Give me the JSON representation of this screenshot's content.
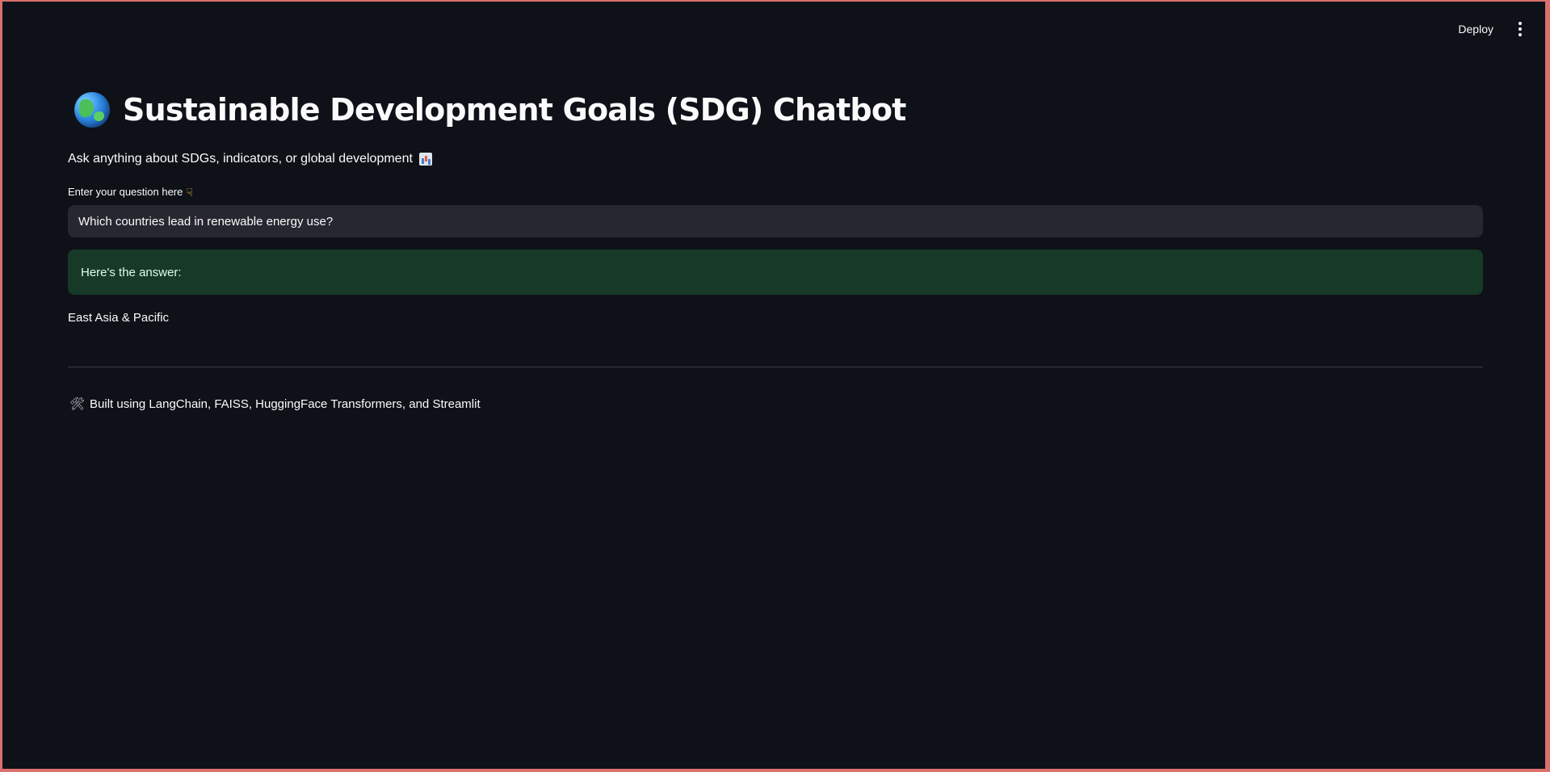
{
  "header": {
    "deploy_label": "Deploy",
    "menu_icon": "more-vertical-icon"
  },
  "main": {
    "title_icon": "globe-icon",
    "title": "Sustainable Development Goals (SDG) Chatbot",
    "subtitle": "Ask anything about SDGs, indicators, or global development",
    "subtitle_icon": "bar-chart-icon",
    "question_label": "Enter your question here",
    "question_label_icon": "point-down-icon",
    "question_value": "Which countries lead in renewable energy use?",
    "success_message": "Here's the answer:",
    "answer": "East Asia & Pacific",
    "footer_icon": "tools-icon",
    "footer_text": "Built using LangChain, FAISS, HuggingFace Transformers, and Streamlit"
  },
  "colors": {
    "background": "#0e1118",
    "input_background": "#262730",
    "success_background": "#173928",
    "text": "#fafafa",
    "window_border": "#d9706c"
  }
}
